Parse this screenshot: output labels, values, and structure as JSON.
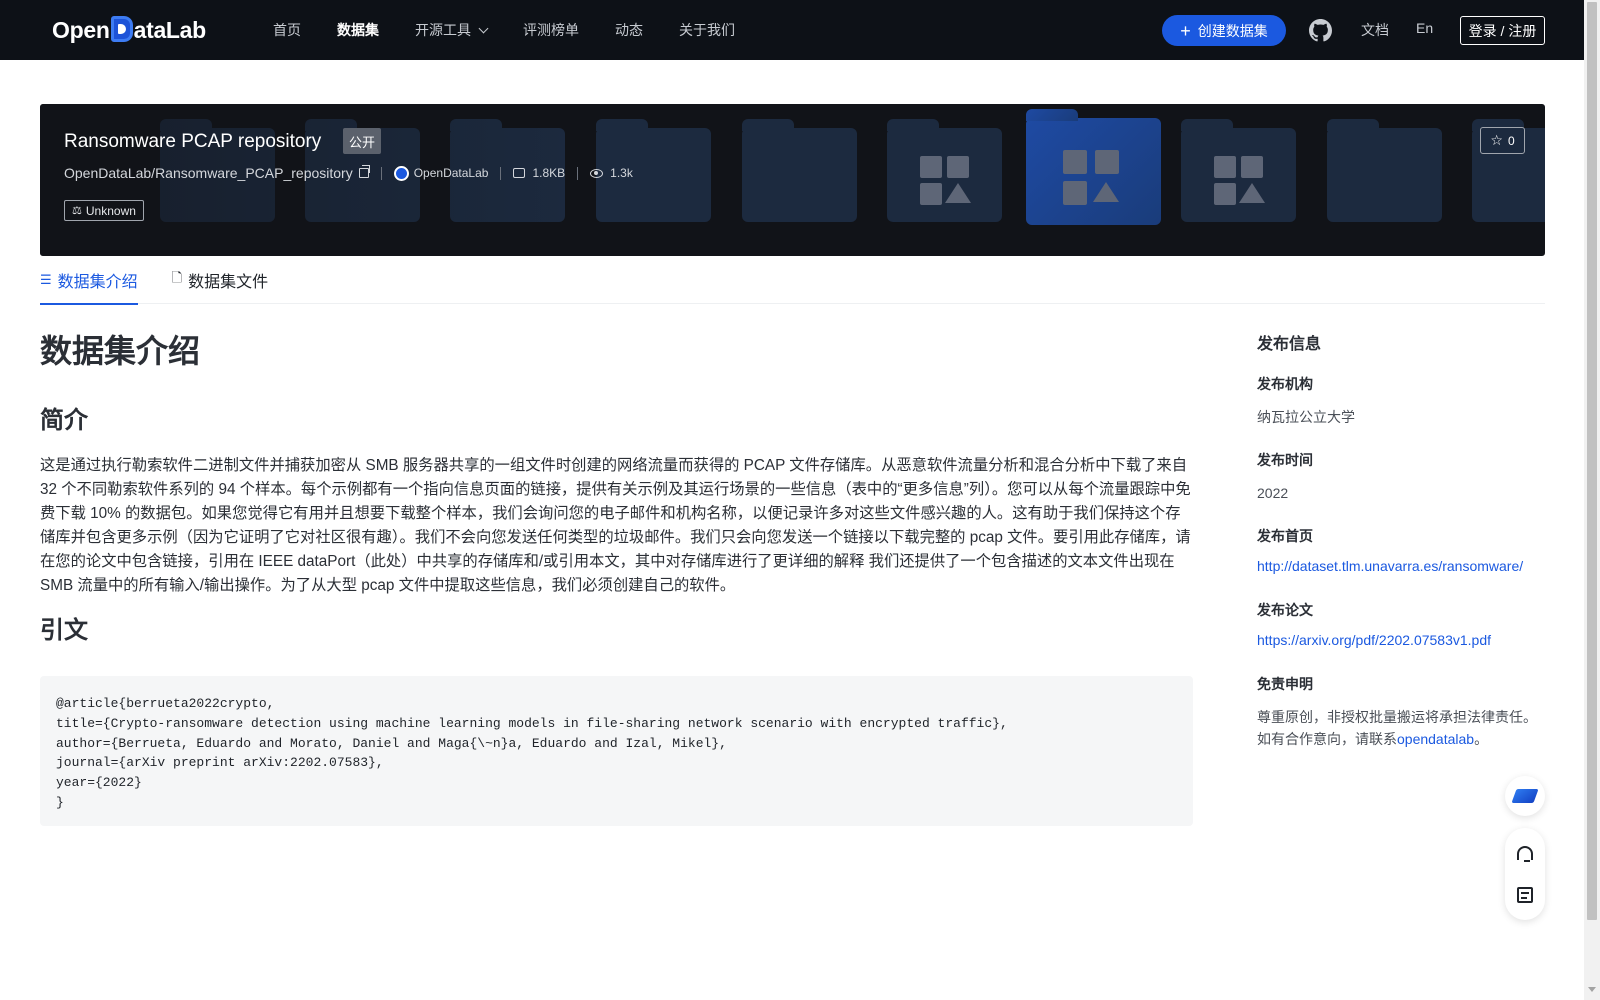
{
  "nav": {
    "logo_part1": "Open",
    "logo_part2": "ataLab",
    "links": [
      "首页",
      "数据集",
      "开源工具",
      "评测榜单",
      "动态",
      "关于我们"
    ],
    "create_button": "创建数据集",
    "docs": "文档",
    "lang": "En",
    "login": "登录 / 注册"
  },
  "dataset": {
    "title": "Ransomware PCAP repository",
    "visibility": "公开",
    "path": "OpenDataLab/Ransomware_PCAP_repository",
    "org": "OpenDataLab",
    "size": "1.8KB",
    "views": "1.3k",
    "license": "Unknown",
    "stars": "0"
  },
  "tabs": [
    "数据集介绍",
    "数据集文件"
  ],
  "content": {
    "heading": "数据集介绍",
    "intro_heading": "简介",
    "intro_text": "这是通过执行勒索软件二进制文件并捕获加密从 SMB 服务器共享的一组文件时创建的网络流量而获得的 PCAP 文件存储库。从恶意软件流量分析和混合分析中下载了来自 32 个不同勒索软件系列的 94 个样本。每个示例都有一个指向信息页面的链接，提供有关示例及其运行场景的一些信息（表中的“更多信息”列）。您可以从每个流量跟踪中免费下载 10% 的数据包。如果您觉得它有用并且想要下载整个样本，我们会询问您的电子邮件和机构名称，以便记录许多对这些文件感兴趣的人。这有助于我们保持这个存储库并包含更多示例（因为它证明了它对社区很有趣）。我们不会向您发送任何类型的垃圾邮件。我们只会向您发送一个链接以下载完整的 pcap 文件。要引用此存储库，请在您的论文中包含链接，引用在 IEEE dataPort（此处）中共享的存储库和/或引用本文，其中对存储库进行了更详细的解释 我们还提供了一个包含描述的文本文件出现在 SMB 流量中的所有输入/输出操作。为了从大型 pcap 文件中提取这些信息，我们必须创建自己的软件。",
    "citation_heading": "引文",
    "citation": "@article{berrueta2022crypto,\ntitle={Crypto-ransomware detection using machine learning models in file-sharing network scenario with encrypted traffic},\nauthor={Berrueta, Eduardo and Morato, Daniel and Maga{\\~n}a, Eduardo and Izal, Mikel},\njournal={arXiv preprint arXiv:2202.07583},\nyear={2022}\n}"
  },
  "sidebar": {
    "title": "发布信息",
    "org_label": "发布机构",
    "org_value": "纳瓦拉公立大学",
    "time_label": "发布时间",
    "time_value": "2022",
    "home_label": "发布首页",
    "home_value": "http://dataset.tlm.unavarra.es/ransomware/",
    "paper_label": "发布论文",
    "paper_value": "https://arxiv.org/pdf/2202.07583v1.pdf",
    "disclaimer_label": "免责申明",
    "disclaimer_line1": "尊重原创，非授权批量搬运将承担法律责任。",
    "disclaimer_line2": "如有合作意向，请联系",
    "disclaimer_link": "opendatalab",
    "disclaimer_end": "。"
  },
  "colors": {
    "nav_bg": "#0d1117",
    "accent": "#1b59e0",
    "banner_bg": "#111318"
  }
}
